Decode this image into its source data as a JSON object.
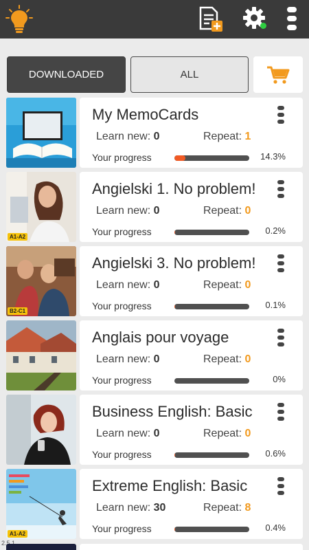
{
  "header": {
    "logo_icon": "lightbulb-logo-icon",
    "add_icon": "add-document-icon",
    "settings_icon": "gear-icon",
    "menu_icon": "more-vertical-icon"
  },
  "tabs": {
    "downloaded": "DOWNLOADED",
    "all": "ALL",
    "cart_icon": "shopping-cart-icon"
  },
  "labels": {
    "learn_new": "Learn new:",
    "repeat": "Repeat:",
    "your_progress": "Your progress"
  },
  "courses": [
    {
      "title": "My MemoCards",
      "learn_new": "0",
      "repeat": "1",
      "progress": "14.3%",
      "progress_value": 0.143,
      "level": ""
    },
    {
      "title": "Angielski 1. No problem!",
      "learn_new": "0",
      "repeat": "0",
      "progress": "0.2%",
      "progress_value": 0.002,
      "level": "A1-A2"
    },
    {
      "title": "Angielski 3. No problem!",
      "learn_new": "0",
      "repeat": "0",
      "progress": "0.1%",
      "progress_value": 0.001,
      "level": "B2-C1"
    },
    {
      "title": "Anglais pour voyage",
      "learn_new": "0",
      "repeat": "0",
      "progress": "0%",
      "progress_value": 0.0,
      "level": ""
    },
    {
      "title": "Business English: Basic",
      "learn_new": "0",
      "repeat": "0",
      "progress": "0.6%",
      "progress_value": 0.006,
      "level": ""
    },
    {
      "title": "Extreme English: Basic",
      "learn_new": "30",
      "repeat": "8",
      "progress": "0.4%",
      "progress_value": 0.004,
      "level": "A1-A2"
    }
  ],
  "footer": {
    "version": "2.5.1"
  },
  "colors": {
    "accent": "#f29a1e",
    "progress_fill": "#f15a24",
    "header_bg": "#3a3a3a"
  }
}
